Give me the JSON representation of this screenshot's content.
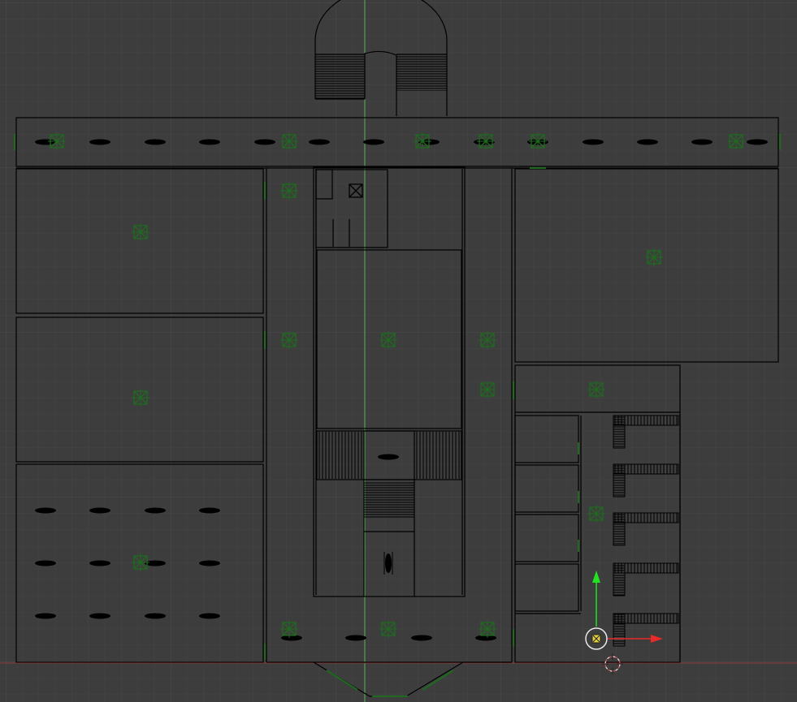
{
  "viewport": {
    "editor": "3d-viewport-top-orthographic",
    "background_color": "#3d3d3d",
    "grid_minor_color": "#454545",
    "grid_major_color": "#4b4b4b",
    "axis_x_color": "#8a3a3a",
    "axis_y_color": "#5bb35b",
    "wire_color": "#000000",
    "lamp_color": "#1f6a1f",
    "fixture_color": "#000000"
  },
  "gizmo": {
    "x_arrow_color": "#e82a2a",
    "y_arrow_color": "#22e322",
    "origin_ring_color": "#e8e8e8",
    "cursor_color": "#e8e8e8",
    "cursor_accent_color": "#e05050",
    "selected_object_color": "#e6d23c"
  },
  "icons": {
    "lamp": "point-lamp-icon",
    "fixture": "ceiling-fixture-icon",
    "transform_widget": "move-gizmo-icon",
    "cursor": "3d-cursor-icon"
  }
}
